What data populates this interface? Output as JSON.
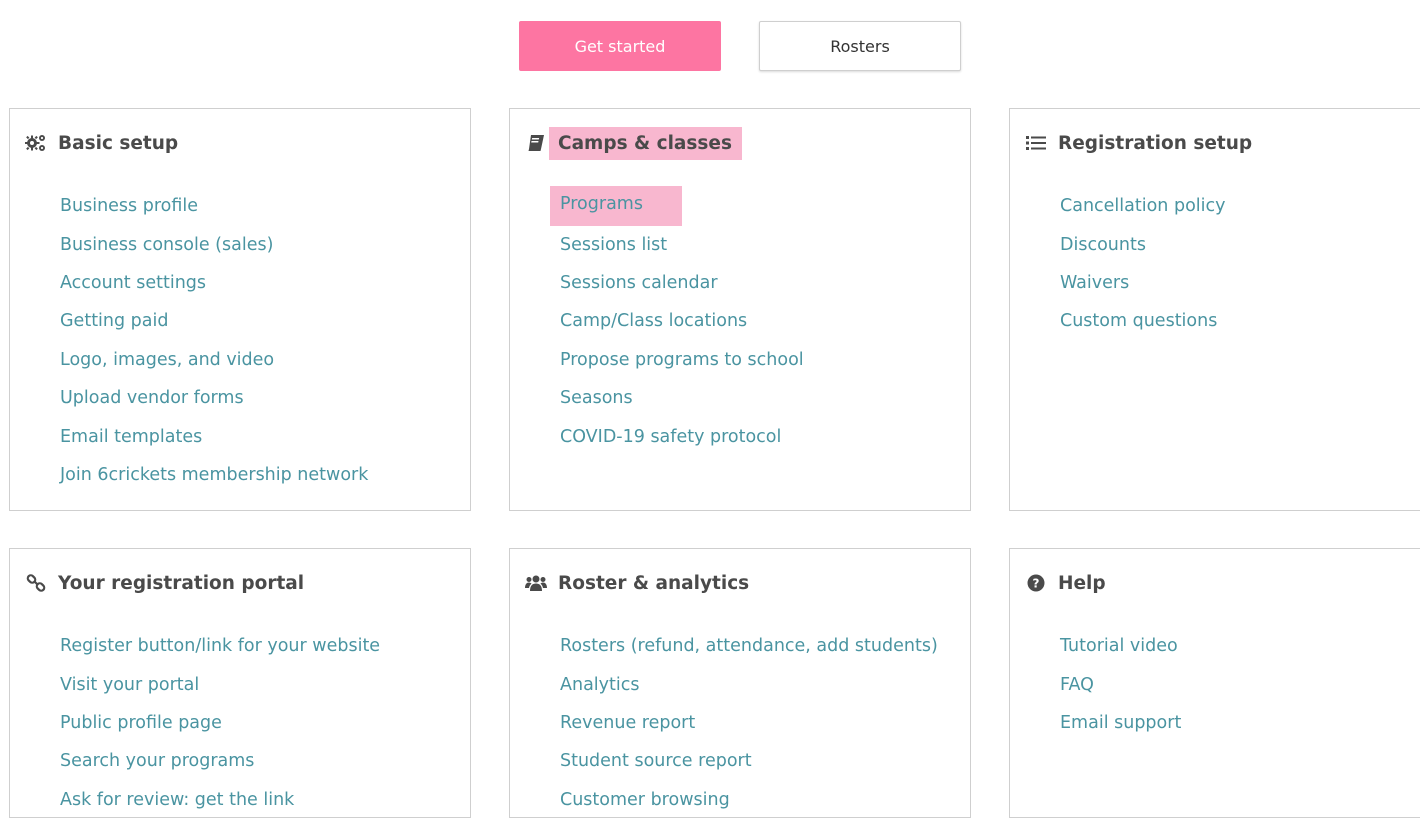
{
  "top_buttons": {
    "get_started": "Get started",
    "rosters": "Rosters"
  },
  "colors": {
    "accent": "#fd75a2",
    "highlight": "#f8b7cf",
    "link": "#4a94a1",
    "title": "#4a4a4a",
    "border": "#cfcfcf"
  },
  "cards": {
    "basic_setup": {
      "title": "Basic setup",
      "icon": "gears-icon",
      "links": [
        "Business profile",
        "Business console (sales)",
        "Account settings",
        "Getting paid",
        "Logo, images, and video",
        "Upload vendor forms",
        "Email templates",
        "Join 6crickets membership network"
      ]
    },
    "camps_classes": {
      "title": "Camps & classes",
      "icon": "book-icon",
      "links": [
        "Programs",
        "Sessions list",
        "Sessions calendar",
        "Camp/Class locations",
        "Propose programs to school",
        "Seasons",
        "COVID-19 safety protocol"
      ]
    },
    "registration_setup": {
      "title": "Registration setup",
      "icon": "list-icon",
      "links": [
        "Cancellation policy",
        "Discounts",
        "Waivers",
        "Custom questions"
      ]
    },
    "registration_portal": {
      "title": "Your registration portal",
      "icon": "link-icon",
      "links": [
        "Register button/link for your website",
        "Visit your portal",
        "Public profile page",
        "Search your programs",
        "Ask for review: get the link"
      ]
    },
    "roster_analytics": {
      "title": "Roster & analytics",
      "icon": "users-icon",
      "links": [
        "Rosters (refund, attendance, add students)",
        "Analytics",
        "Revenue report",
        "Student source report",
        "Customer browsing"
      ]
    },
    "help": {
      "title": "Help",
      "icon": "question-circle-icon",
      "links": [
        "Tutorial video",
        "FAQ",
        "Email support"
      ]
    }
  }
}
